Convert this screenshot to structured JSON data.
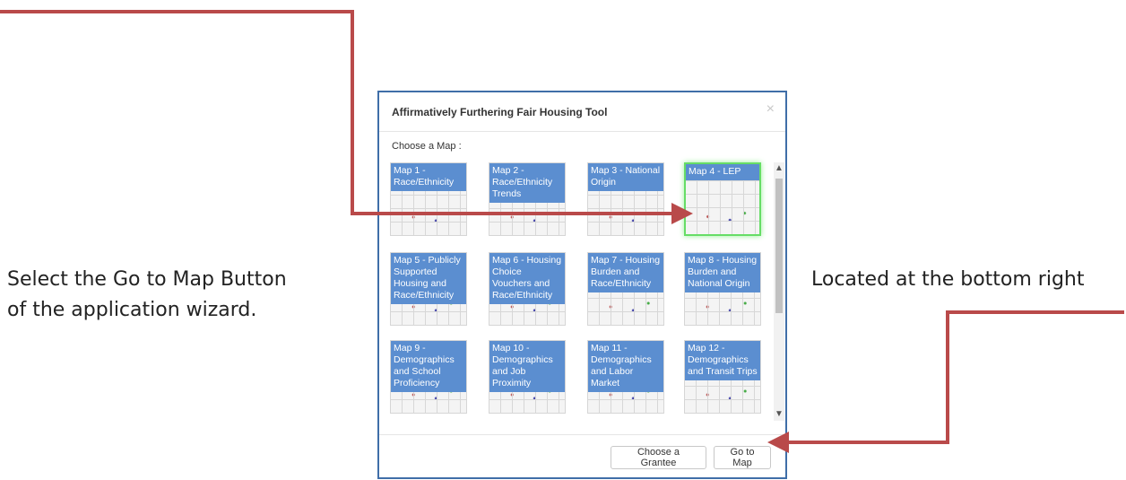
{
  "annotations": {
    "left_line1": "Select the Go to Map Button",
    "left_line2": "of the application wizard.",
    "right_line": "Located at the bottom right",
    "arrow_color": "#b94a4a"
  },
  "dialog": {
    "title": "Affirmatively Furthering Fair Housing Tool",
    "close_glyph": "×",
    "choose_label": "Choose a Map :",
    "maps": [
      {
        "label": "Map 1 - Race/Ethnicity"
      },
      {
        "label": "Map 2 - Race/Ethnicity Trends"
      },
      {
        "label": "Map 3 - National Origin"
      },
      {
        "label": "Map 4 - LEP"
      },
      {
        "label": "Map 5 - Publicly Supported Housing and Race/Ethnicity"
      },
      {
        "label": "Map 6 - Housing Choice Vouchers and Race/Ethnicity"
      },
      {
        "label": "Map 7 - Housing Burden and Race/Ethnicity"
      },
      {
        "label": "Map 8 - Housing Burden and National Origin"
      },
      {
        "label": "Map 9 - Demographics and School Proficiency"
      },
      {
        "label": "Map 10 - Demographics and Job Proximity"
      },
      {
        "label": "Map 11 - Demographics and Labor Market"
      },
      {
        "label": "Map 12 - Demographics and Transit Trips"
      }
    ],
    "selected_map": "Map 4 - LEP",
    "buttons": {
      "choose_grantee": "Choose a Grantee",
      "go_to_map": "Go to Map"
    },
    "scroll_up_icon": "▲",
    "scroll_down_icon": "▼"
  }
}
